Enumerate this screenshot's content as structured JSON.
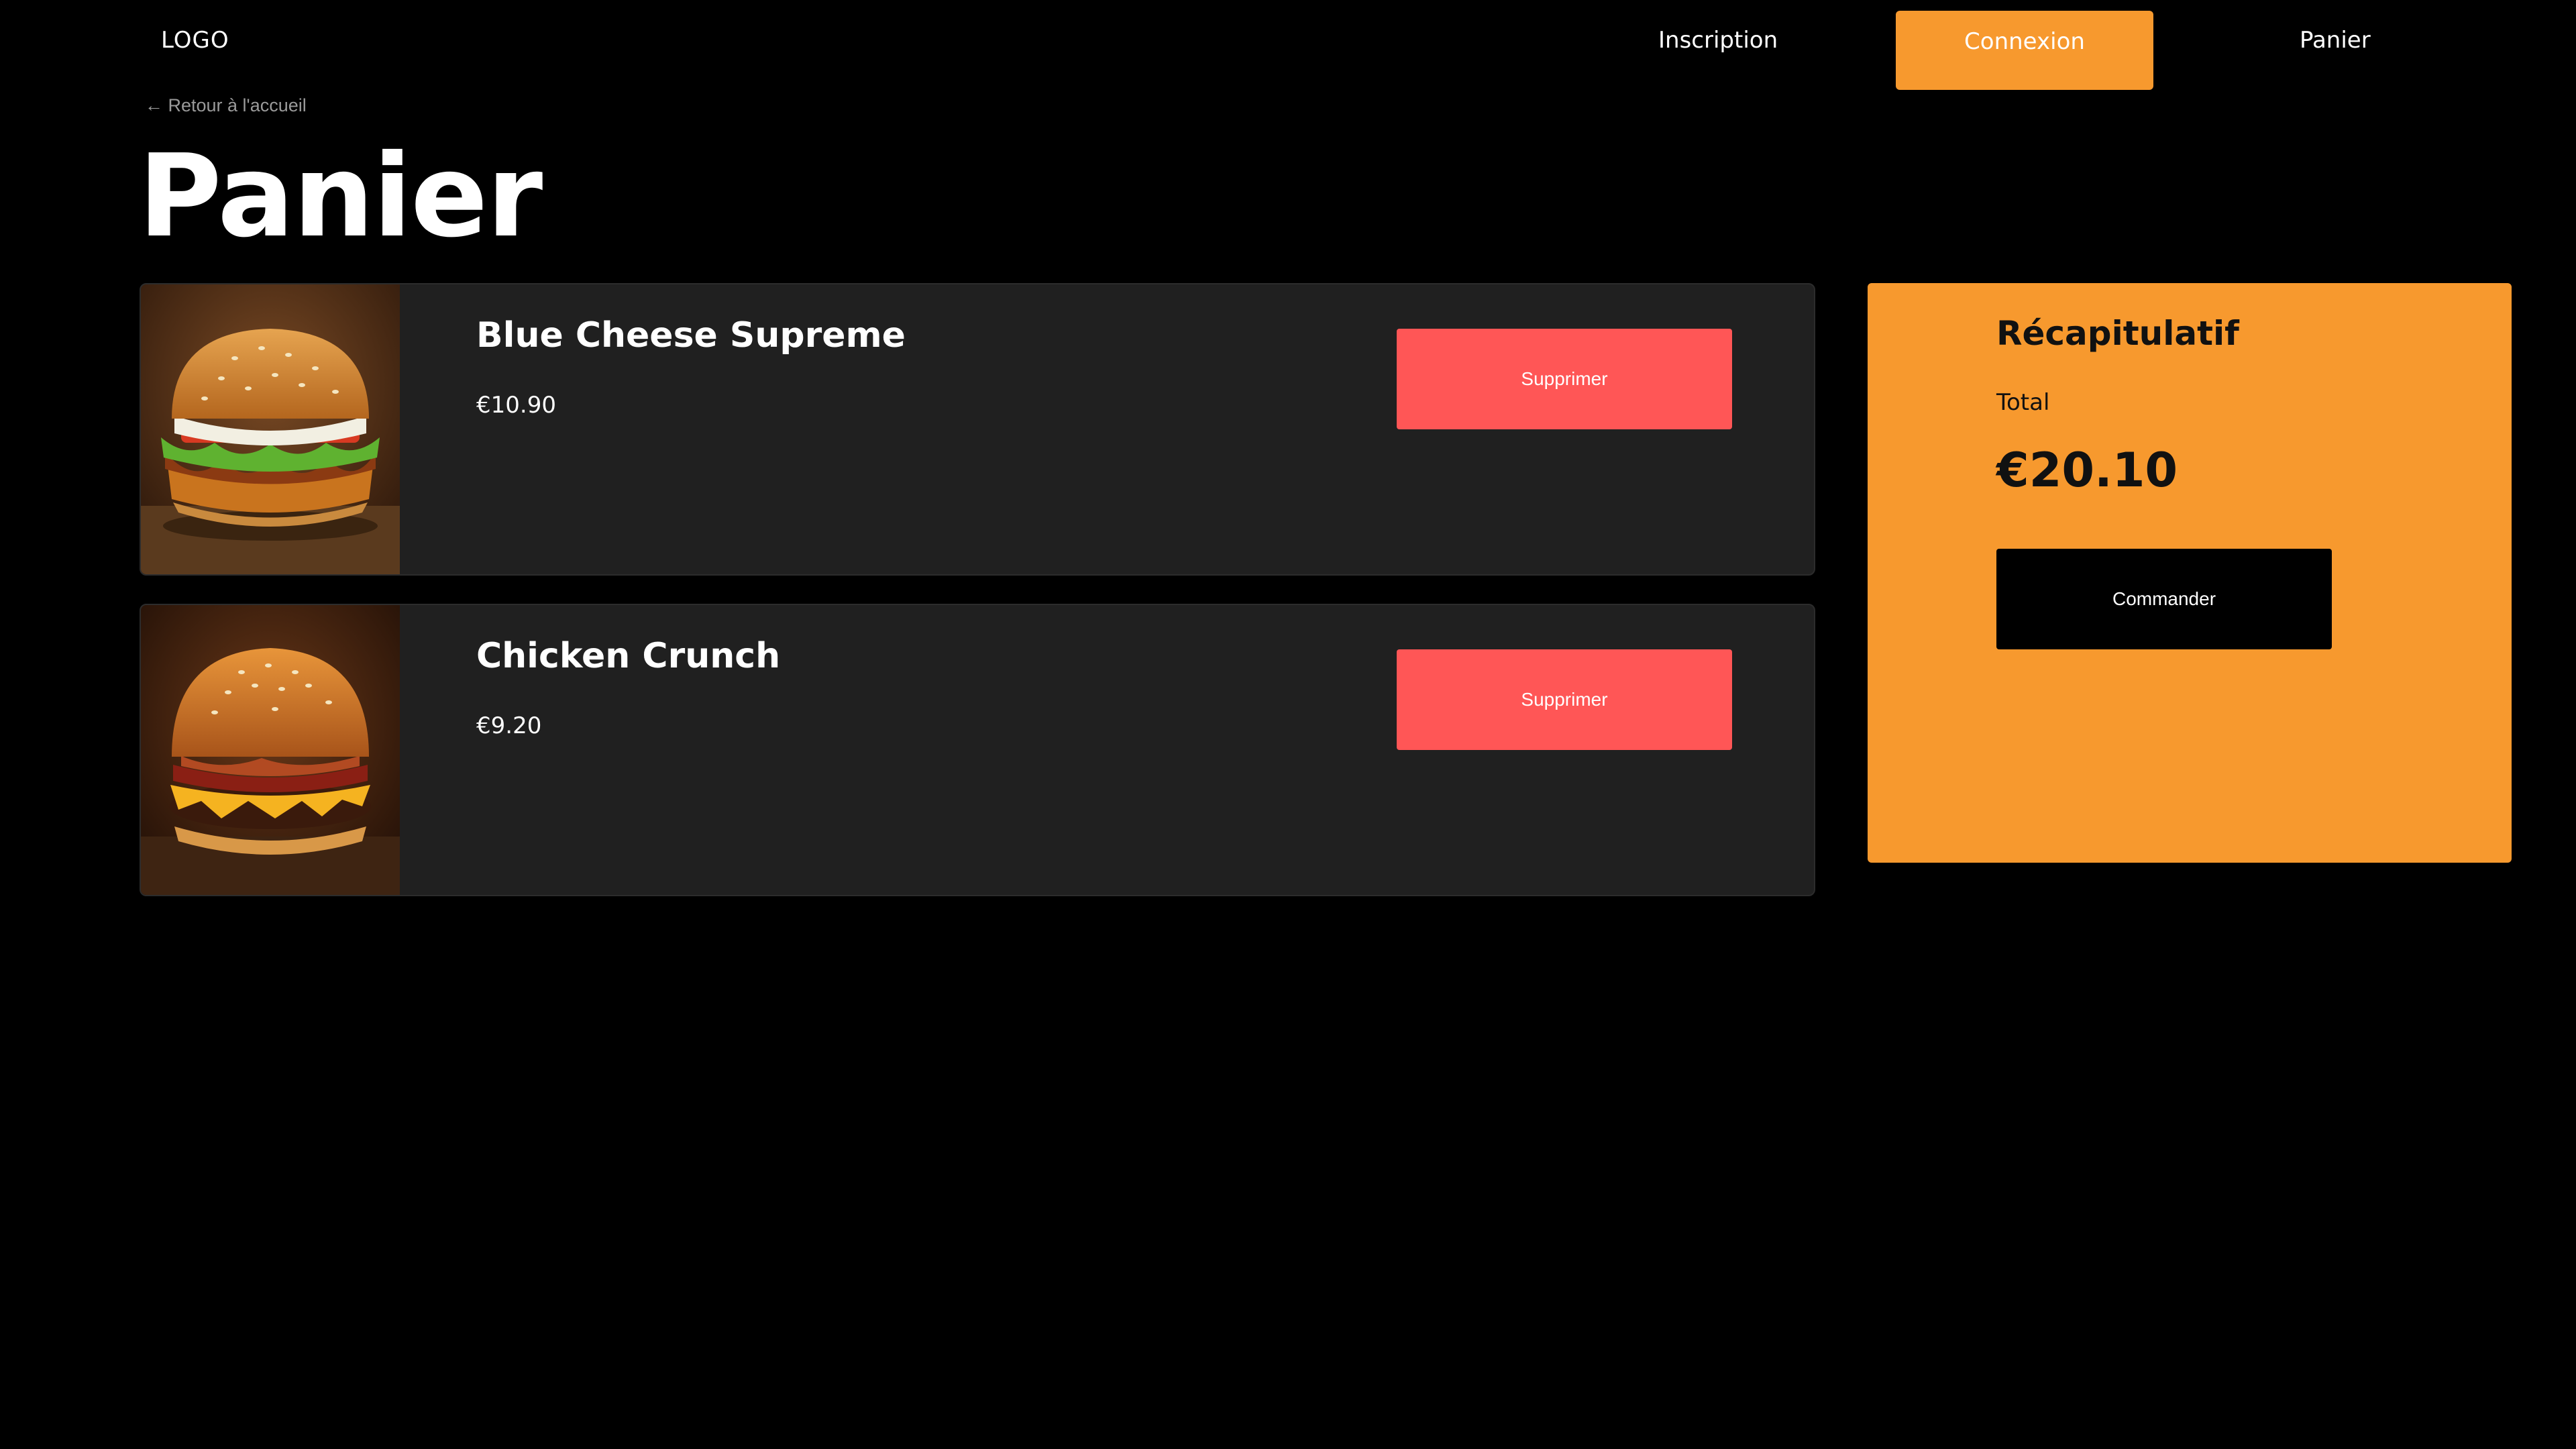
{
  "header": {
    "logo": "LOGO",
    "nav": {
      "inscription": "Inscription",
      "connexion": "Connexion",
      "panier": "Panier"
    }
  },
  "back_link": "← Retour à l'accueil",
  "page_title": "Panier",
  "cart": {
    "items": [
      {
        "name": "Blue Cheese Supreme",
        "price": "€10.90",
        "delete_label": "Supprimer"
      },
      {
        "name": "Chicken Crunch",
        "price": "€9.20",
        "delete_label": "Supprimer"
      }
    ]
  },
  "summary": {
    "title": "Récapitulatif",
    "total_label": "Total",
    "total_value": "€20.10",
    "order_label": "Commander"
  },
  "colors": {
    "accent": "#f7992e",
    "delete": "#ff5656",
    "card": "#202020",
    "background": "#000000"
  }
}
